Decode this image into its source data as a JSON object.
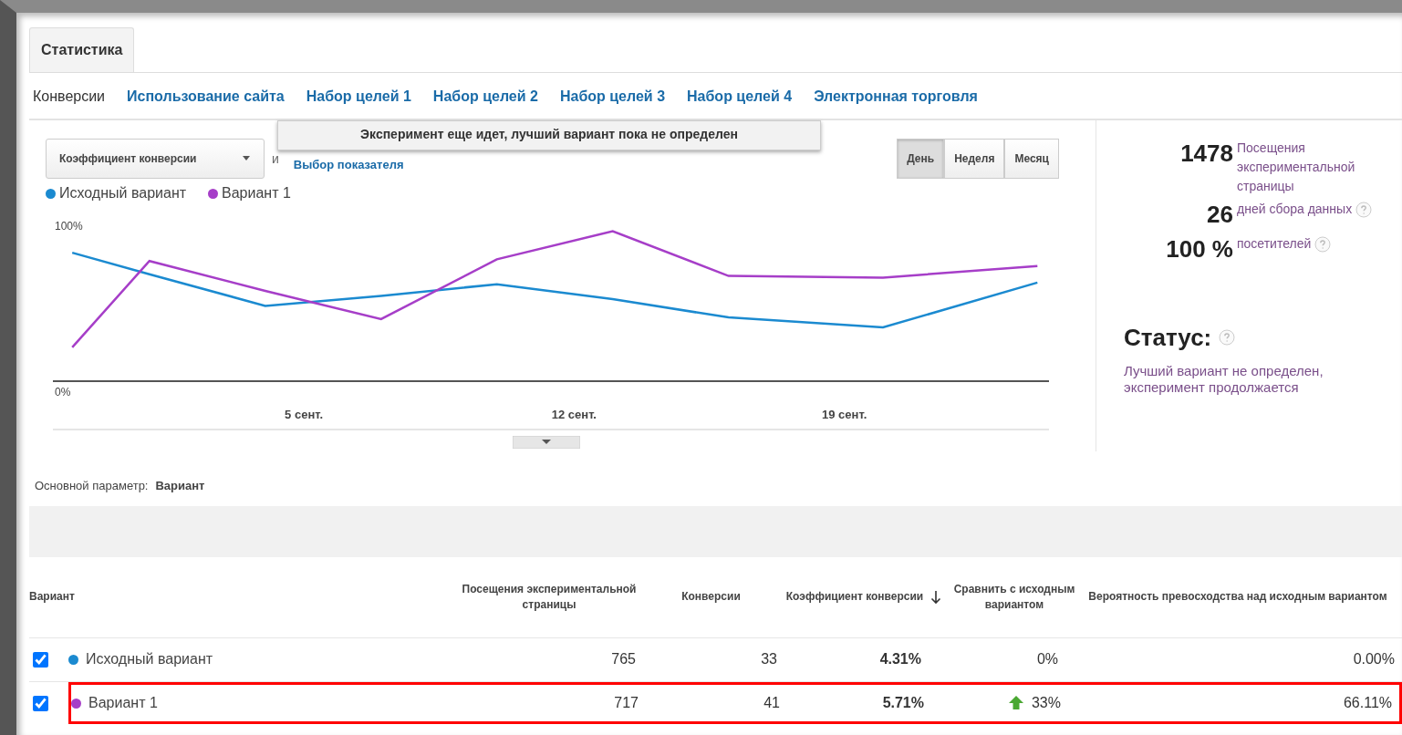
{
  "tabs": [
    {
      "label": "Статистика",
      "selected": true
    }
  ],
  "subnav": [
    {
      "label": "Конверсии",
      "selected": true
    },
    {
      "label": "Использование сайта",
      "selected": false
    },
    {
      "label": "Набор целей 1",
      "selected": false
    },
    {
      "label": "Набор целей 2",
      "selected": false
    },
    {
      "label": "Набор целей 3",
      "selected": false
    },
    {
      "label": "Набор целей 4",
      "selected": false
    },
    {
      "label": "Электронная торговля",
      "selected": false
    }
  ],
  "notice": "Эксперимент еще идет, лучший вариант пока не определен",
  "metric_select": {
    "value": "Коэффициент конверсии"
  },
  "conjunction": "и",
  "metric_link": "Выбор показателя",
  "periods": [
    {
      "label": "День",
      "selected": true
    },
    {
      "label": "Неделя",
      "selected": false
    },
    {
      "label": "Месяц",
      "selected": false
    }
  ],
  "chart_data": {
    "type": "line",
    "x": [
      -1,
      1,
      4,
      7,
      10,
      13,
      16,
      20,
      24
    ],
    "xlim": [
      -1.5,
      24.3
    ],
    "ylim": [
      0,
      100
    ],
    "xticks": [
      {
        "value": 5,
        "label": "5 сент."
      },
      {
        "value": 12,
        "label": "12 сент."
      },
      {
        "value": 19,
        "label": "19 сент."
      }
    ],
    "yticks": [
      {
        "value": 0,
        "label": "0%"
      },
      {
        "value": 100,
        "label": "100%"
      }
    ],
    "legend": "top",
    "series": [
      {
        "name": "Исходный вариант",
        "color": "#1b8ad0",
        "values": [
          84,
          71,
          52,
          58,
          65,
          56,
          45,
          39,
          66
        ]
      },
      {
        "name": "Вариант 1",
        "color": "#a63ec8",
        "values": [
          27,
          79,
          61,
          44,
          80,
          97,
          70,
          69,
          76
        ]
      }
    ]
  },
  "summary": {
    "stats": [
      {
        "value": "1478",
        "label": "Посещения экспериментальной страницы",
        "help": false
      },
      {
        "value": "26",
        "label": "дней сбора данных",
        "help": true
      },
      {
        "value": "100 %",
        "label": "посетителей",
        "help": true
      }
    ],
    "status_title": "Статус:",
    "status_help": true,
    "status_text": "Лучший вариант не определен, эксперимент продолжается"
  },
  "dimension": {
    "label": "Основной параметр:",
    "value": "Вариант"
  },
  "table": {
    "columns": [
      {
        "label": "Вариант",
        "sorted": false
      },
      {
        "label": "Посещения экспериментальной страницы",
        "sorted": false
      },
      {
        "label": "Конверсии",
        "sorted": false
      },
      {
        "label": "Коэффициент конверсии",
        "sorted": true
      },
      {
        "label": "Сравнить с исходным вариантом",
        "sorted": false
      },
      {
        "label": "Вероятность превосходства над исходным вариантом",
        "sorted": false
      }
    ],
    "rows": [
      {
        "checked": true,
        "color": "#1b8ad0",
        "name": "Исходный вариант",
        "visits": "765",
        "conversions": "33",
        "rate": "4.31%",
        "improved": false,
        "compare": "0%",
        "probability": "0.00%",
        "highlighted": false
      },
      {
        "checked": true,
        "color": "#a63ec8",
        "name": "Вариант 1",
        "visits": "717",
        "conversions": "41",
        "rate": "5.71%",
        "improved": true,
        "compare": "33%",
        "probability": "66.11%",
        "highlighted": true
      }
    ]
  }
}
